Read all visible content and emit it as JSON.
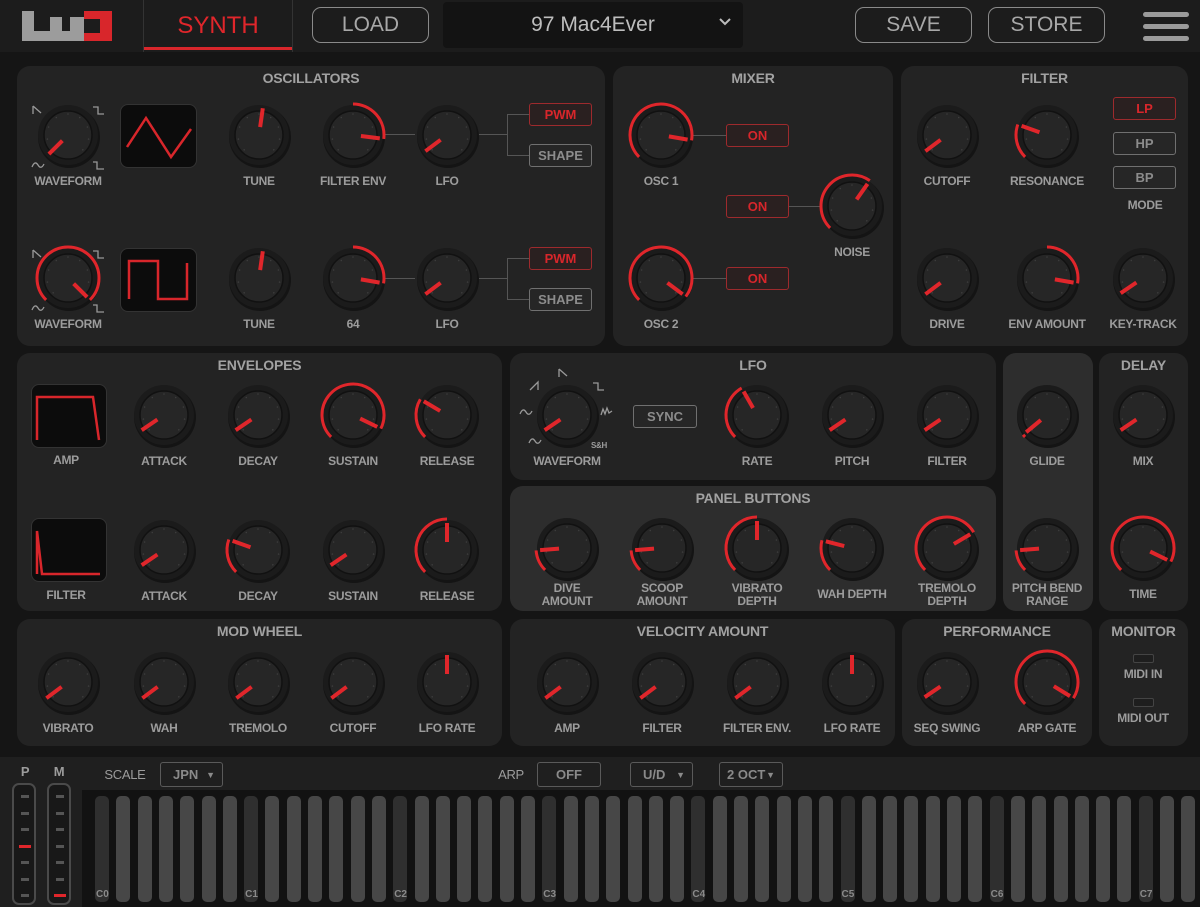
{
  "colors": {
    "accent": "#e0262b",
    "panel": "#232323",
    "panel_light": "#2d2d2d",
    "background": "#151515"
  },
  "header": {
    "logo": "UNO",
    "synth_tab": "SYNTH",
    "load": "LOAD",
    "preset": "97 Mac4Ever",
    "save": "SAVE",
    "store": "STORE",
    "menu_icon": "hamburger-menu-icon"
  },
  "oscillators": {
    "title": "OSCILLATORS",
    "osc1": {
      "waveform": {
        "label": "WAVEFORM",
        "value": 0.0,
        "arc": "none"
      },
      "wave_display": "triangle",
      "tune": {
        "label": "TUNE",
        "value": 0.53,
        "arc": "none"
      },
      "filter_env": {
        "label": "FILTER ENV",
        "value": 0.86,
        "arc": "center"
      },
      "lfo": {
        "label": "LFO",
        "value": 0.03,
        "arc": "none"
      },
      "pwm": "PWM",
      "shape": "SHAPE",
      "pwm_active": true
    },
    "osc2": {
      "waveform": {
        "label": "WAVEFORM",
        "value": 1.0,
        "arc": "min"
      },
      "wave_display": "square",
      "tune": {
        "label": "TUNE",
        "value": 0.53,
        "arc": "none"
      },
      "mod": {
        "label": "64",
        "value": 0.87,
        "arc": "center"
      },
      "lfo": {
        "label": "LFO",
        "value": 0.03,
        "arc": "none"
      },
      "pwm": "PWM",
      "shape": "SHAPE",
      "pwm_active": true
    }
  },
  "mixer": {
    "title": "MIXER",
    "osc1": {
      "label": "OSC 1",
      "value": 0.87,
      "arc": "min"
    },
    "osc2": {
      "label": "OSC 2",
      "value": 0.97,
      "arc": "min"
    },
    "noise": {
      "label": "NOISE",
      "value": 0.63,
      "arc": "min"
    },
    "on1": "ON",
    "on_noise": "ON",
    "on2": "ON"
  },
  "filter": {
    "title": "FILTER",
    "cutoff": {
      "label": "CUTOFF",
      "value": 0.03,
      "arc": "none"
    },
    "resonance": {
      "label": "RESONANCE",
      "value": 0.24,
      "arc": "min"
    },
    "drive": {
      "label": "DRIVE",
      "value": 0.03,
      "arc": "none"
    },
    "env_amount": {
      "label": "ENV AMOUNT",
      "value": 0.87,
      "arc": "center"
    },
    "key_track": {
      "label": "KEY-TRACK",
      "value": 0.04,
      "arc": "none"
    },
    "modes": [
      "LP",
      "HP",
      "BP"
    ],
    "mode_selected": "LP",
    "mode_label": "MODE"
  },
  "envelopes": {
    "title": "ENVELOPES",
    "amp": {
      "label": "AMP",
      "attack": {
        "label": "ATTACK",
        "value": 0.04,
        "arc": "none"
      },
      "decay": {
        "label": "DECAY",
        "value": 0.04,
        "arc": "none"
      },
      "sustain": {
        "label": "SUSTAIN",
        "value": 0.93,
        "arc": "min"
      },
      "release": {
        "label": "RELEASE",
        "value": 0.28,
        "arc": "min"
      }
    },
    "filter": {
      "label": "FILTER",
      "attack": {
        "label": "ATTACK",
        "value": 0.04,
        "arc": "none"
      },
      "decay": {
        "label": "DECAY",
        "value": 0.24,
        "arc": "min"
      },
      "sustain": {
        "label": "SUSTAIN",
        "value": 0.04,
        "arc": "none"
      },
      "release": {
        "label": "RELEASE",
        "value": 0.5,
        "arc": "min"
      }
    }
  },
  "lfo": {
    "title": "LFO",
    "waveform": {
      "label": "WAVEFORM",
      "value": 0.04,
      "arc": "none"
    },
    "sync": "SYNC",
    "sh_label": "S&H",
    "rate": {
      "label": "RATE",
      "value": 0.39,
      "arc": "min"
    },
    "pitch": {
      "label": "PITCH",
      "value": 0.04,
      "arc": "none"
    },
    "filter": {
      "label": "FILTER",
      "value": 0.04,
      "arc": "none"
    }
  },
  "panel_buttons": {
    "title": "PANEL BUTTONS",
    "dive": {
      "label": "DIVE\nAMOUNT",
      "value": 0.15,
      "arc": "min"
    },
    "scoop": {
      "label": "SCOOP\nAMOUNT",
      "value": 0.15,
      "arc": "min"
    },
    "vibrato": {
      "label": "VIBRATO\nDEPTH",
      "value": 0.5,
      "arc": "min"
    },
    "wah": {
      "label": "WAH DEPTH",
      "value": 0.22,
      "arc": "min"
    },
    "tremolo": {
      "label": "TREMOLO\nDEPTH",
      "value": 0.72,
      "arc": "min"
    }
  },
  "glide": {
    "glide": {
      "label": "GLIDE",
      "value": 0.02,
      "arc": "min"
    },
    "pitch_bend": {
      "label": "PITCH BEND\nRANGE",
      "value": 0.15,
      "arc": "min"
    }
  },
  "delay": {
    "title": "DELAY",
    "mix": {
      "label": "MIX",
      "value": 0.04,
      "arc": "none"
    },
    "time": {
      "label": "TIME",
      "value": 0.93,
      "arc": "min"
    }
  },
  "mod_wheel": {
    "title": "MOD WHEEL",
    "vibrato": {
      "label": "VIBRATO",
      "value": 0.03,
      "arc": "none"
    },
    "wah": {
      "label": "WAH",
      "value": 0.03,
      "arc": "none"
    },
    "tremolo": {
      "label": "TREMOLO",
      "value": 0.03,
      "arc": "none"
    },
    "cutoff": {
      "label": "CUTOFF",
      "value": 0.03,
      "arc": "none"
    },
    "lfo_rate": {
      "label": "LFO RATE",
      "value": 0.5,
      "arc": "none"
    }
  },
  "velocity": {
    "title": "VELOCITY AMOUNT",
    "amp": {
      "label": "AMP",
      "value": 0.03,
      "arc": "none"
    },
    "filter": {
      "label": "FILTER",
      "value": 0.03,
      "arc": "none"
    },
    "filter_env": {
      "label": "FILTER ENV.",
      "value": 0.03,
      "arc": "none"
    },
    "lfo_rate": {
      "label": "LFO RATE",
      "value": 0.5,
      "arc": "none"
    }
  },
  "performance": {
    "title": "PERFORMANCE",
    "seq_swing": {
      "label": "SEQ SWING",
      "value": 0.04,
      "arc": "none"
    },
    "arp_gate": {
      "label": "ARP GATE",
      "value": 0.95,
      "arc": "min"
    }
  },
  "monitor": {
    "title": "MONITOR",
    "midi_in": "MIDI IN",
    "midi_out": "MIDI OUT"
  },
  "bottom": {
    "pitch_label": "P",
    "mod_label": "M",
    "pitch_level": 0.5,
    "mod_level": 0.0,
    "scale_label": "SCALE",
    "scale": "JPN",
    "arp_label": "ARP",
    "arp": "OFF",
    "arp_mode": "U/D",
    "arp_range": "2 OCT"
  },
  "keyboard": {
    "octave_labels": [
      "C0",
      "C1",
      "C2",
      "C3",
      "C4",
      "C5",
      "C6",
      "C7"
    ]
  }
}
